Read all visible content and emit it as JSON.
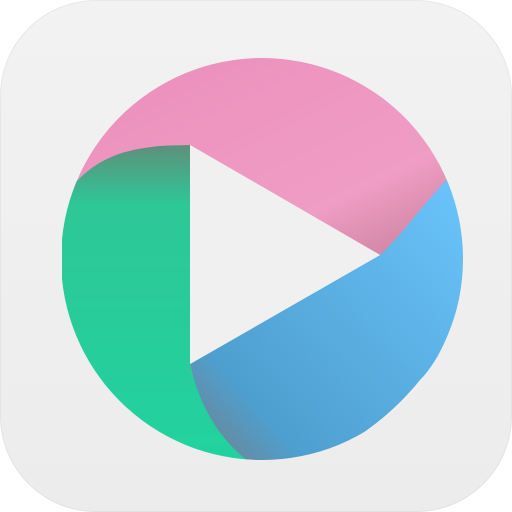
{
  "app_icon": {
    "icon_name": "media-player-play-icon",
    "colors": {
      "tile_background": "#f0f0f0",
      "pink": "#ef9ac2",
      "green": "#22d19c",
      "blue": "#5fb6ea",
      "center_play": "#f0f0f0"
    }
  }
}
